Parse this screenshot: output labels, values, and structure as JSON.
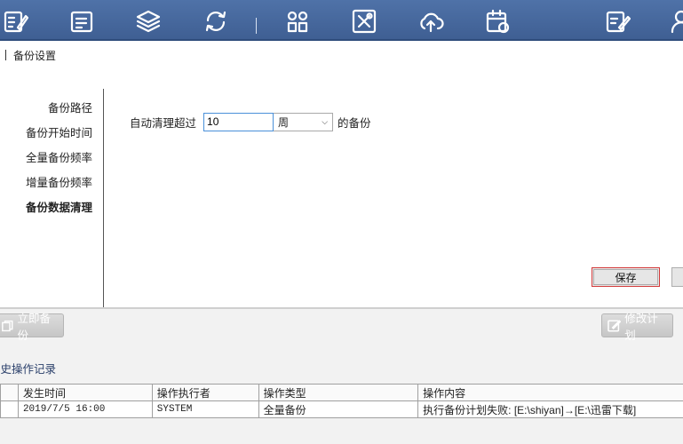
{
  "toolbar": {
    "icons": [
      "edit-list-icon",
      "document-icon",
      "layers-icon",
      "sync-icon",
      "apps-icon",
      "tools-icon",
      "cloud-upload-icon",
      "calendar-icon",
      "edit-note-icon",
      "user-edit-icon"
    ]
  },
  "breadcrumb": {
    "title": "备份设置"
  },
  "settings_nav": {
    "items": [
      {
        "label": "备份路径"
      },
      {
        "label": "备份开始时间"
      },
      {
        "label": "全量备份频率"
      },
      {
        "label": "增量备份频率"
      },
      {
        "label": "备份数据清理",
        "active": true
      }
    ]
  },
  "cleanup": {
    "label": "自动清理超过",
    "value": "10",
    "unit_selected": "周",
    "suffix": "的备份"
  },
  "buttons": {
    "save": "保存",
    "backup_now": "立即备份",
    "modify_plan": "修改计划"
  },
  "history": {
    "title": "历史操作记录",
    "columns": [
      "发生时间",
      "操作执行者",
      "操作类型",
      "操作内容"
    ],
    "rows": [
      [
        "2019/7/5 16:00",
        "SYSTEM",
        "全量备份",
        "执行备份计划失败: [E:\\shiyan]→[E:\\迅雷下载]"
      ]
    ]
  },
  "colors": {
    "toolbar": "#4f72a8",
    "save_border": "#d23a3a",
    "input_border": "#4a90d9"
  }
}
